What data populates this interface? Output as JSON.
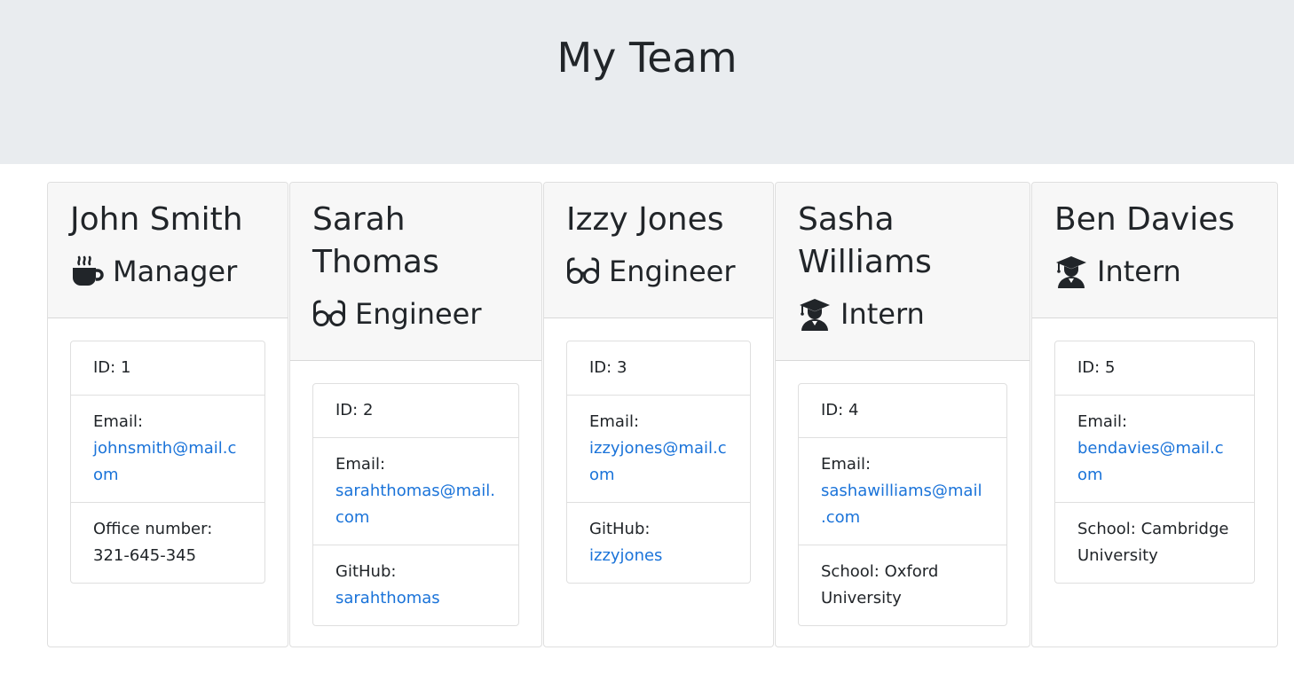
{
  "header": {
    "title": "My Team"
  },
  "team": [
    {
      "name": "John Smith",
      "role": "Manager",
      "role_icon": "mug-icon",
      "id_text": "ID: 1",
      "email_label": "Email:",
      "email": "johnsmith@mail.com",
      "extra_label": "Office number:",
      "extra_value": "321-645-345"
    },
    {
      "name": "Sarah Thomas",
      "role": "Engineer",
      "role_icon": "glasses-icon",
      "id_text": "ID: 2",
      "email_label": "Email:",
      "email": "sarahthomas@mail.com",
      "extra_label": "GitHub:",
      "extra_value": "sarahthomas"
    },
    {
      "name": "Izzy Jones",
      "role": "Engineer",
      "role_icon": "glasses-icon",
      "id_text": "ID: 3",
      "email_label": "Email:",
      "email": "izzyjones@mail.com",
      "extra_label": "GitHub:",
      "extra_value": "izzyjones"
    },
    {
      "name": "Sasha Williams",
      "role": "Intern",
      "role_icon": "graduate-icon",
      "id_text": "ID: 4",
      "email_label": "Email:",
      "email": "sashawilliams@mail.com",
      "extra_label": "School:",
      "extra_value": "Oxford University"
    },
    {
      "name": "Ben Davies",
      "role": "Intern",
      "role_icon": "graduate-icon",
      "id_text": "ID: 5",
      "email_label": "Email:",
      "email": "bendavies@mail.com",
      "extra_label": "School:",
      "extra_value": "Cambridge University"
    }
  ],
  "colors": {
    "link": "#1a73d9",
    "jumbotron": "#e9ecef",
    "card_header": "#f7f7f7"
  }
}
